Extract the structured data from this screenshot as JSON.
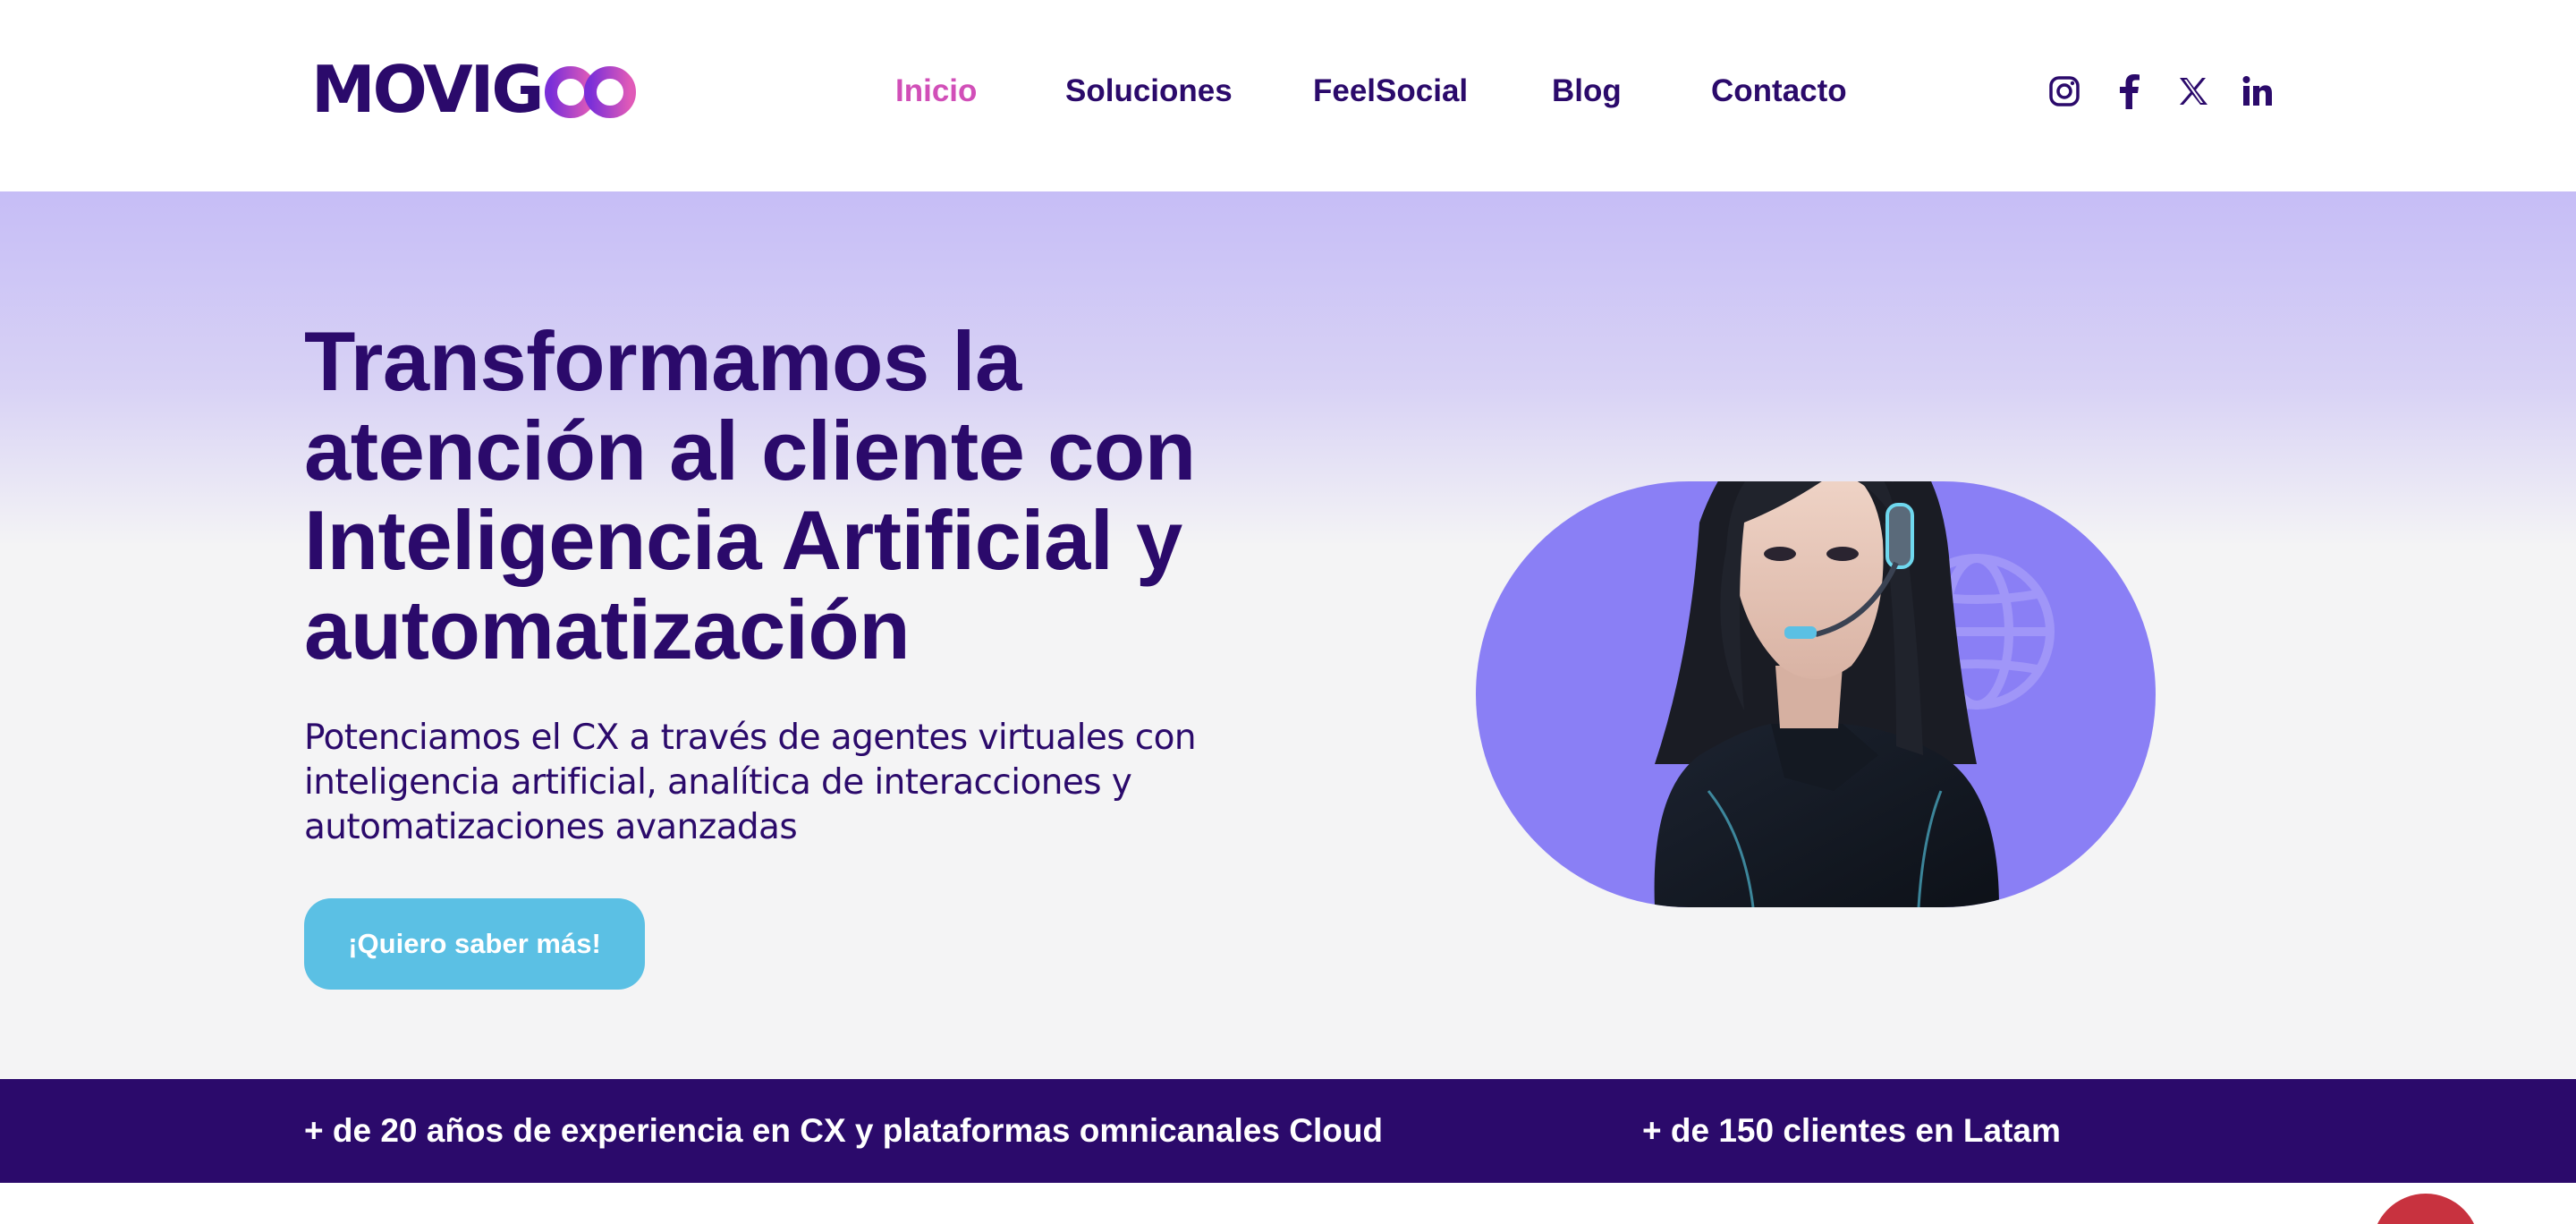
{
  "header": {
    "logo_text": "MOVIG",
    "nav": {
      "inicio": "Inicio",
      "soluciones": "Soluciones",
      "feelsocial": "FeelSocial",
      "blog": "Blog",
      "contacto": "Contacto"
    },
    "social_icons": [
      "instagram-icon",
      "facebook-icon",
      "x-icon",
      "linkedin-icon"
    ]
  },
  "hero": {
    "title": "Transformamos la atención al cliente con Inteligencia Artificial y automatización",
    "subtitle": "Potenciamos el CX a través de agentes virtuales con inteligencia artificial, analítica de interacciones y automatizaciones avanzadas",
    "cta_label": "¡Quiero saber más!"
  },
  "stats": {
    "experience": "+ de 20 años de experiencia en CX y plataformas omnicanales Cloud",
    "clients": "+ de 150 clientes en Latam"
  },
  "colors": {
    "brand_dark": "#2b0a6b",
    "brand_pink": "#d14fb8",
    "cta": "#5bc0e4",
    "hero_blob": "#8a7ff5",
    "chat": "#c8323f"
  }
}
